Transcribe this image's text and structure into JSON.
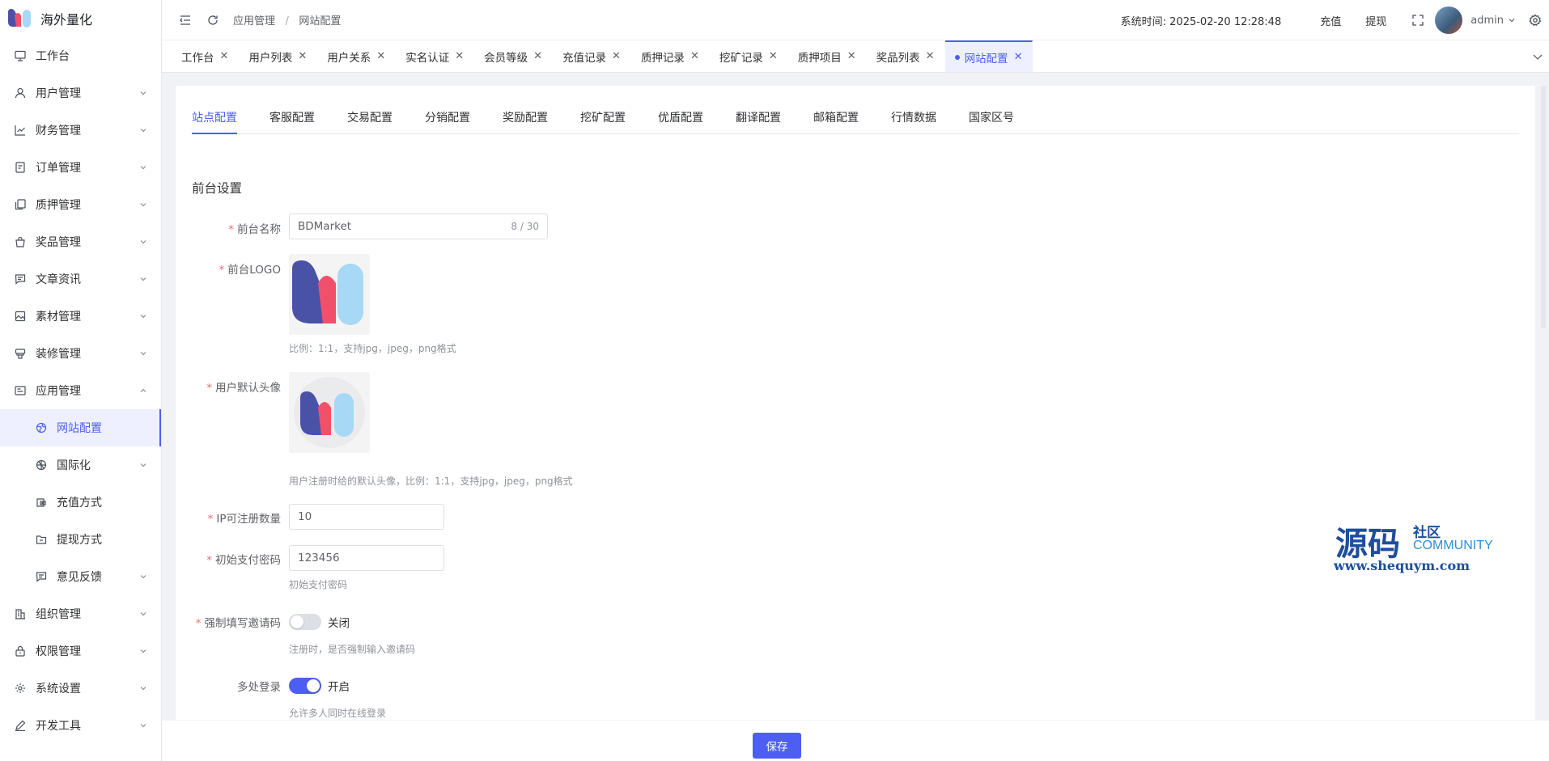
{
  "brand": {
    "name": "海外量化"
  },
  "sidebar": {
    "items": [
      {
        "label": "工作台",
        "icon": "monitor-icon",
        "expandable": false
      },
      {
        "label": "用户管理",
        "icon": "user-icon",
        "expandable": true
      },
      {
        "label": "财务管理",
        "icon": "chart-icon",
        "expandable": true
      },
      {
        "label": "订单管理",
        "icon": "order-icon",
        "expandable": true
      },
      {
        "label": "质押管理",
        "icon": "pledge-icon",
        "expandable": true
      },
      {
        "label": "奖品管理",
        "icon": "gift-bag-icon",
        "expandable": true
      },
      {
        "label": "文章资讯",
        "icon": "message-icon",
        "expandable": true
      },
      {
        "label": "素材管理",
        "icon": "image-icon",
        "expandable": true
      },
      {
        "label": "装修管理",
        "icon": "brush-icon",
        "expandable": true
      },
      {
        "label": "应用管理",
        "icon": "app-icon",
        "expandable": true,
        "expanded": true
      }
    ],
    "sub_items": [
      {
        "label": "网站配置",
        "icon": "globe-icon",
        "active": true
      },
      {
        "label": "国际化",
        "icon": "language-icon",
        "expandable": true
      },
      {
        "label": "充值方式",
        "icon": "wallet-icon"
      },
      {
        "label": "提现方式",
        "icon": "folder-icon"
      },
      {
        "label": "意见反馈",
        "icon": "feedback-icon",
        "expandable": true
      }
    ],
    "bottom_items": [
      {
        "label": "组织管理",
        "icon": "building-icon"
      },
      {
        "label": "权限管理",
        "icon": "lock-icon"
      },
      {
        "label": "系统设置",
        "icon": "gear-icon"
      },
      {
        "label": "开发工具",
        "icon": "pen-icon"
      }
    ]
  },
  "header": {
    "breadcrumb_1": "应用管理",
    "breadcrumb_sep": "/",
    "breadcrumb_2": "网站配置",
    "system_time": "系统时间: 2025-02-20 12:28:48",
    "recharge": "充值",
    "withdraw": "提现",
    "username": "admin"
  },
  "tabs": [
    "工作台",
    "用户列表",
    "用户关系",
    "实名认证",
    "会员等级",
    "充值记录",
    "质押记录",
    "挖矿记录",
    "质押项目",
    "奖品列表",
    "网站配置"
  ],
  "subtabs": [
    "站点配置",
    "客服配置",
    "交易配置",
    "分销配置",
    "奖励配置",
    "挖矿配置",
    "优盾配置",
    "翻译配置",
    "邮箱配置",
    "行情数据",
    "国家区号"
  ],
  "form": {
    "section_title": "前台设置",
    "site_name_label": "前台名称",
    "site_name_value": "BDMarket",
    "site_name_counter": "8 / 30",
    "logo_label": "前台LOGO",
    "logo_hint": "比例：1:1，支持jpg，jpeg，png格式",
    "avatar_label": "用户默认头像",
    "avatar_hint": "用户注册时给的默认头像，比例：1:1，支持jpg，jpeg，png格式",
    "ip_limit_label": "IP可注册数量",
    "ip_limit_value": "10",
    "pay_pwd_label": "初始支付密码",
    "pay_pwd_value": "123456",
    "pay_pwd_hint": "初始支付密码",
    "invite_label": "强制填写邀请码",
    "invite_state": "关闭",
    "invite_hint": "注册时，是否强制输入邀请码",
    "multi_login_label": "多处登录",
    "multi_login_state": "开启",
    "multi_login_hint": "允许多人同时在线登录"
  },
  "footer": {
    "save": "保存"
  },
  "watermark": {
    "big": "源码",
    "small1": "社区",
    "small2": "COMMUNITY",
    "url": "www.shequym.com"
  },
  "colors": {
    "accent": "#4d5ef2",
    "required": "#f56c6c"
  }
}
